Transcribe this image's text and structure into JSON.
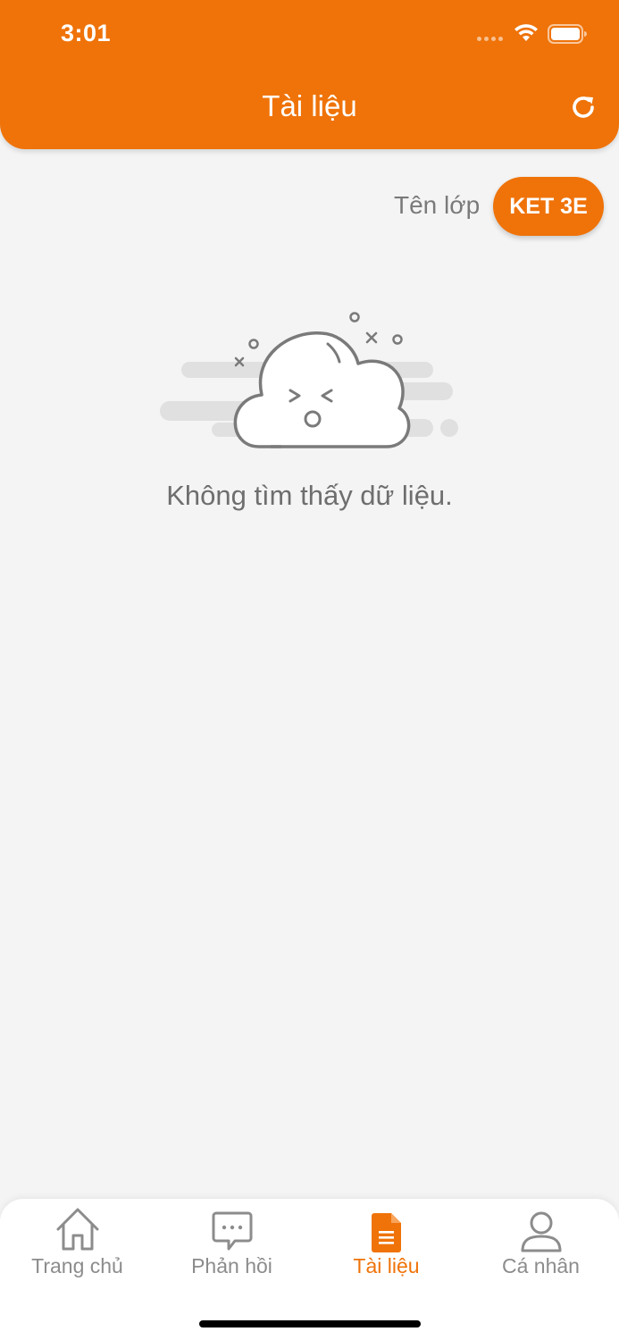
{
  "status_bar": {
    "time": "3:01"
  },
  "header": {
    "title": "Tài liệu"
  },
  "class_selector": {
    "label": "Tên lớp",
    "value": "KET 3E"
  },
  "empty_state": {
    "message": "Không tìm thấy dữ liệu."
  },
  "nav": {
    "items": [
      {
        "label": "Trang chủ",
        "icon": "home-icon",
        "active": false
      },
      {
        "label": "Phản hồi",
        "icon": "chat-icon",
        "active": false
      },
      {
        "label": "Tài liệu",
        "icon": "document-icon",
        "active": true
      },
      {
        "label": "Cá nhân",
        "icon": "person-icon",
        "active": false
      }
    ]
  },
  "colors": {
    "accent": "#ef7309",
    "background": "#f4f4f4",
    "muted_text": "#7a7a7a",
    "nav_inactive": "#8c8c8c"
  }
}
